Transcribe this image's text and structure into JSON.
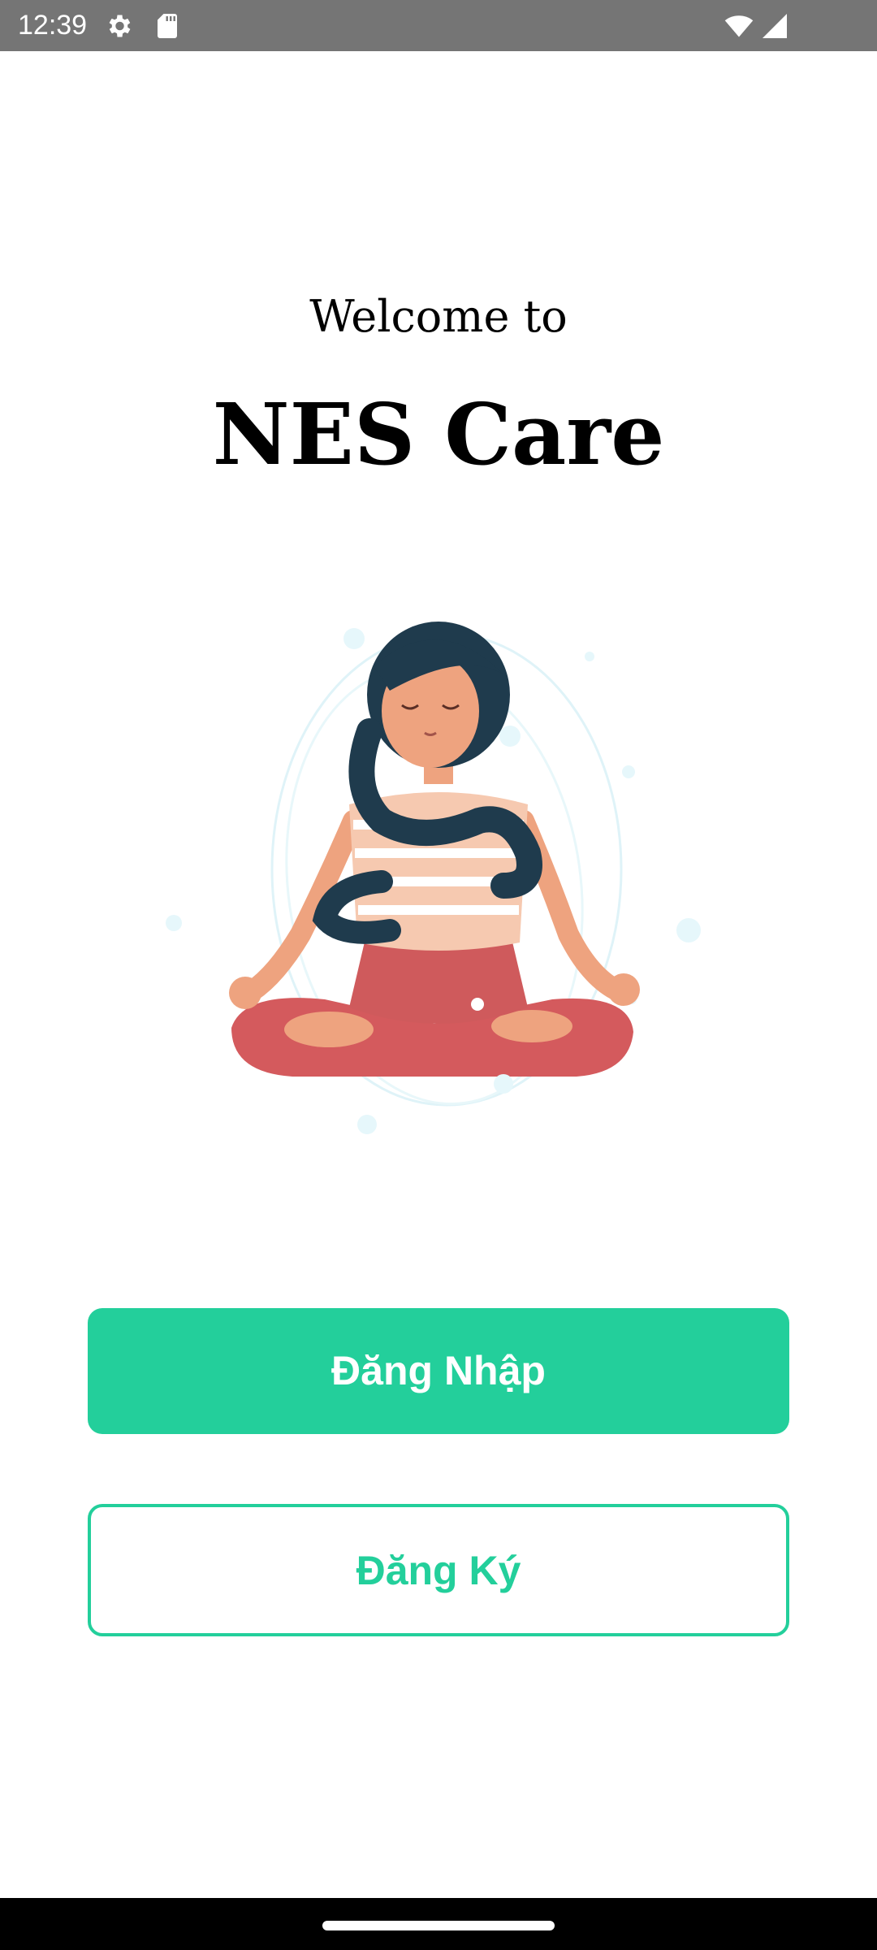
{
  "status_bar": {
    "time": "12:39",
    "left_icons": [
      "gear-icon",
      "sd-card-icon"
    ],
    "right_icons": [
      "wifi-icon",
      "cell-signal-icon"
    ]
  },
  "welcome": {
    "line1": "Welcome to",
    "app_name": "NES Care"
  },
  "illustration": {
    "subject": "meditating-woman-illustration"
  },
  "buttons": {
    "login_label": "Đăng Nhập",
    "register_label": "Đăng Ký"
  },
  "colors": {
    "accent": "#23cf9b",
    "status_bar": "#757575",
    "nav_bar": "#000000"
  }
}
